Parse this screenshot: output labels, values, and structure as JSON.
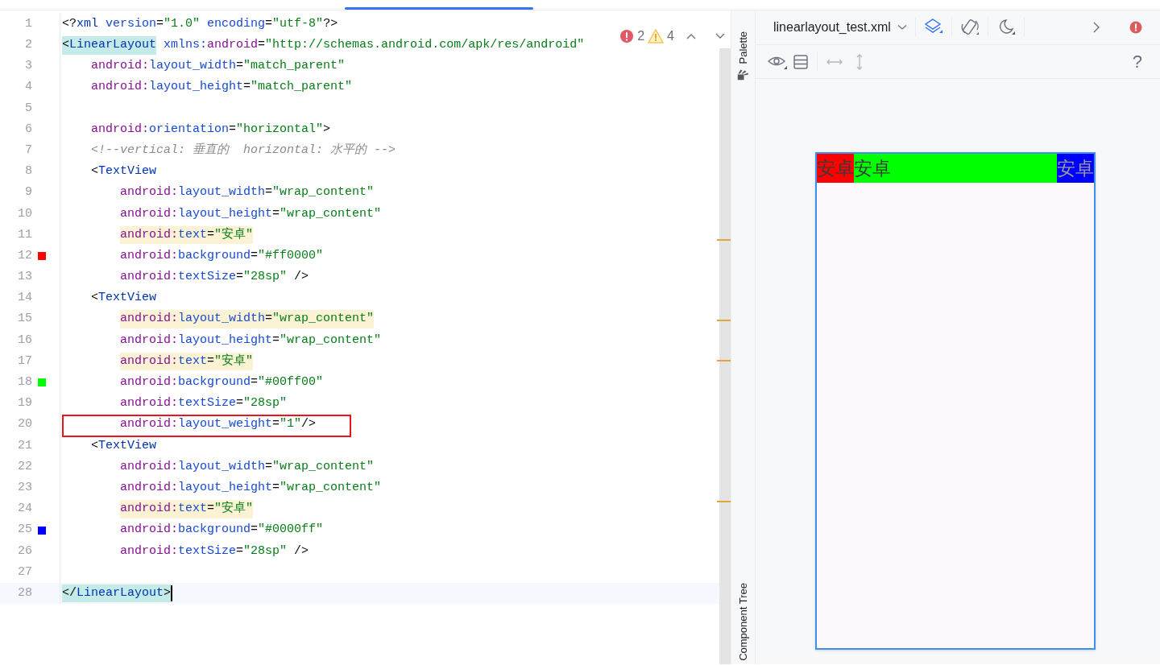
{
  "inspections": {
    "errors": "2",
    "warnings": "4"
  },
  "code_lines": [
    {
      "number": "1",
      "tokens": [
        {
          "kind": "punct",
          "text": "<?"
        },
        {
          "kind": "tag",
          "text": "xml"
        },
        {
          "kind": "attr",
          "text": " version"
        },
        {
          "kind": "punct",
          "text": "="
        },
        {
          "kind": "value",
          "text": "\"1.0\""
        },
        {
          "kind": "attr",
          "text": " encoding"
        },
        {
          "kind": "punct",
          "text": "="
        },
        {
          "kind": "value",
          "text": "\"utf-8\""
        },
        {
          "kind": "punct",
          "text": "?>"
        }
      ]
    },
    {
      "number": "2",
      "tokens": [
        {
          "kind": "punct",
          "text": "<",
          "brace_match": true
        },
        {
          "kind": "tag",
          "text": "LinearLayout",
          "brace_match": true
        },
        {
          "kind": "attr",
          "text": " xmlns:"
        },
        {
          "kind": "ns",
          "text": "android"
        },
        {
          "kind": "punct",
          "text": "="
        },
        {
          "kind": "value",
          "text": "\"http://schemas.android.com/apk/res/android\""
        }
      ],
      "children": [
        {
          "number": "3",
          "tokens": [
            {
              "kind": "ns",
              "text": "android:"
            },
            {
              "kind": "attr",
              "text": "layout_width"
            },
            {
              "kind": "punct",
              "text": "="
            },
            {
              "kind": "value",
              "text": "\"match_parent\""
            }
          ]
        },
        {
          "number": "4",
          "tokens": [
            {
              "kind": "ns",
              "text": "android:"
            },
            {
              "kind": "attr",
              "text": "layout_height"
            },
            {
              "kind": "punct",
              "text": "="
            },
            {
              "kind": "value",
              "text": "\"match_parent\""
            }
          ]
        },
        {
          "number": "5"
        },
        {
          "number": "6",
          "tokens": [
            {
              "kind": "ns",
              "text": "android:"
            },
            {
              "kind": "attr",
              "text": "orientation"
            },
            {
              "kind": "punct",
              "text": "="
            },
            {
              "kind": "value",
              "text": "\"horizontal\""
            },
            {
              "kind": "punct",
              "text": ">"
            }
          ]
        },
        {
          "number": "7",
          "tokens": [
            {
              "kind": "comment",
              "text": "<!--vertical: 垂直的  horizontal: 水平的 -->"
            }
          ]
        },
        {
          "number": "8",
          "tokens": [
            {
              "kind": "punct",
              "text": "<"
            },
            {
              "kind": "tag",
              "text": "TextView"
            }
          ],
          "children": [
            {
              "number": "9",
              "tokens": [
                {
                  "kind": "ns",
                  "text": "android:"
                },
                {
                  "kind": "attr",
                  "text": "layout_width"
                },
                {
                  "kind": "punct",
                  "text": "="
                },
                {
                  "kind": "value",
                  "text": "\"wrap_content\""
                }
              ]
            },
            {
              "number": "10",
              "tokens": [
                {
                  "kind": "ns",
                  "text": "android:"
                },
                {
                  "kind": "attr",
                  "text": "layout_height"
                },
                {
                  "kind": "punct",
                  "text": "="
                },
                {
                  "kind": "value",
                  "text": "\"wrap_content\""
                }
              ]
            },
            {
              "number": "11",
              "tokens": [
                {
                  "kind": "ns",
                  "text": "android:",
                  "usage_highlight": true
                },
                {
                  "kind": "attr",
                  "text": "text",
                  "usage_highlight": true
                },
                {
                  "kind": "punct",
                  "text": "=",
                  "usage_highlight": true
                },
                {
                  "kind": "value",
                  "text": "\"安卓\"",
                  "usage_highlight": true
                }
              ]
            },
            {
              "number": "12",
              "color": "#ff0000",
              "tokens": [
                {
                  "kind": "ns",
                  "text": "android:"
                },
                {
                  "kind": "attr",
                  "text": "background"
                },
                {
                  "kind": "punct",
                  "text": "="
                },
                {
                  "kind": "value",
                  "text": "\"#ff0000\""
                }
              ]
            },
            {
              "number": "13",
              "tokens": [
                {
                  "kind": "ns",
                  "text": "android:"
                },
                {
                  "kind": "attr",
                  "text": "textSize"
                },
                {
                  "kind": "punct",
                  "text": "="
                },
                {
                  "kind": "value",
                  "text": "\"28sp\""
                },
                {
                  "kind": "punct",
                  "text": " />"
                }
              ]
            }
          ]
        },
        {
          "number": "14",
          "tokens": [
            {
              "kind": "punct",
              "text": "<"
            },
            {
              "kind": "tag",
              "text": "TextView"
            }
          ],
          "children": [
            {
              "number": "15",
              "tokens": [
                {
                  "kind": "ns",
                  "text": "android:",
                  "usage_highlight": true
                },
                {
                  "kind": "attr",
                  "text": "layout_width",
                  "usage_highlight": true
                },
                {
                  "kind": "punct",
                  "text": "=",
                  "usage_highlight": true
                },
                {
                  "kind": "value",
                  "text": "\"wrap_content\"",
                  "usage_highlight": true
                }
              ]
            },
            {
              "number": "16",
              "tokens": [
                {
                  "kind": "ns",
                  "text": "android:"
                },
                {
                  "kind": "attr",
                  "text": "layout_height"
                },
                {
                  "kind": "punct",
                  "text": "="
                },
                {
                  "kind": "value",
                  "text": "\"wrap_content\""
                }
              ]
            },
            {
              "number": "17",
              "tokens": [
                {
                  "kind": "ns",
                  "text": "android:",
                  "usage_highlight": true
                },
                {
                  "kind": "attr",
                  "text": "text",
                  "usage_highlight": true
                },
                {
                  "kind": "punct",
                  "text": "=",
                  "usage_highlight": true
                },
                {
                  "kind": "value",
                  "text": "\"安卓\"",
                  "usage_highlight": true
                }
              ]
            },
            {
              "number": "18",
              "color": "#00ff00",
              "tokens": [
                {
                  "kind": "ns",
                  "text": "android:"
                },
                {
                  "kind": "attr",
                  "text": "background"
                },
                {
                  "kind": "punct",
                  "text": "="
                },
                {
                  "kind": "value",
                  "text": "\"#00ff00\""
                }
              ]
            },
            {
              "number": "19",
              "tokens": [
                {
                  "kind": "ns",
                  "text": "android:"
                },
                {
                  "kind": "attr",
                  "text": "textSize"
                },
                {
                  "kind": "punct",
                  "text": "="
                },
                {
                  "kind": "value",
                  "text": "\"28sp\""
                }
              ]
            },
            {
              "number": "20",
              "boxed": true,
              "tokens": [
                {
                  "kind": "ns",
                  "text": "android:"
                },
                {
                  "kind": "attr",
                  "text": "layout_weight"
                },
                {
                  "kind": "punct",
                  "text": "="
                },
                {
                  "kind": "value",
                  "text": "\"1\""
                },
                {
                  "kind": "punct",
                  "text": "/>"
                }
              ]
            }
          ]
        },
        {
          "number": "21",
          "tokens": [
            {
              "kind": "punct",
              "text": "<"
            },
            {
              "kind": "tag",
              "text": "TextView"
            }
          ],
          "children": [
            {
              "number": "22",
              "tokens": [
                {
                  "kind": "ns",
                  "text": "android:"
                },
                {
                  "kind": "attr",
                  "text": "layout_width"
                },
                {
                  "kind": "punct",
                  "text": "="
                },
                {
                  "kind": "value",
                  "text": "\"wrap_content\""
                }
              ]
            },
            {
              "number": "23",
              "tokens": [
                {
                  "kind": "ns",
                  "text": "android:"
                },
                {
                  "kind": "attr",
                  "text": "layout_height"
                },
                {
                  "kind": "punct",
                  "text": "="
                },
                {
                  "kind": "value",
                  "text": "\"wrap_content\""
                }
              ]
            },
            {
              "number": "24",
              "tokens": [
                {
                  "kind": "ns",
                  "text": "android:",
                  "usage_highlight": true
                },
                {
                  "kind": "attr",
                  "text": "text",
                  "usage_highlight": true
                },
                {
                  "kind": "punct",
                  "text": "=",
                  "usage_highlight": true
                },
                {
                  "kind": "value",
                  "text": "\"安卓\"",
                  "usage_highlight": true
                }
              ]
            },
            {
              "number": "25",
              "color": "#0000ff",
              "tokens": [
                {
                  "kind": "ns",
                  "text": "android:"
                },
                {
                  "kind": "attr",
                  "text": "background"
                },
                {
                  "kind": "punct",
                  "text": "="
                },
                {
                  "kind": "value",
                  "text": "\"#0000ff\""
                }
              ]
            },
            {
              "number": "26",
              "tokens": [
                {
                  "kind": "ns",
                  "text": "android:"
                },
                {
                  "kind": "attr",
                  "text": "textSize"
                },
                {
                  "kind": "punct",
                  "text": "="
                },
                {
                  "kind": "value",
                  "text": "\"28sp\""
                },
                {
                  "kind": "punct",
                  "text": " />"
                }
              ]
            }
          ]
        },
        {
          "number": "27"
        }
      ]
    },
    {
      "number": "28",
      "current": true,
      "tokens": [
        {
          "kind": "punct",
          "text": "</",
          "brace_match": true
        },
        {
          "kind": "tag",
          "text": "LinearLayout",
          "brace_match": true
        },
        {
          "kind": "punct",
          "text": ">",
          "brace_match": true
        }
      ]
    }
  ],
  "side_tabs": [
    {
      "label": "Palette",
      "kind": "palette"
    },
    {
      "label": "Component Tree",
      "kind": "tree"
    }
  ],
  "preview": {
    "file": "linearlayout_test.xml",
    "help": "?",
    "views": [
      {
        "text": "安卓",
        "color": "#ff0000",
        "stretch": false
      },
      {
        "text": "安卓",
        "color": "#00ff00",
        "stretch": true
      },
      {
        "text": "安卓",
        "color": "#0000ff",
        "stretch": false
      }
    ]
  }
}
